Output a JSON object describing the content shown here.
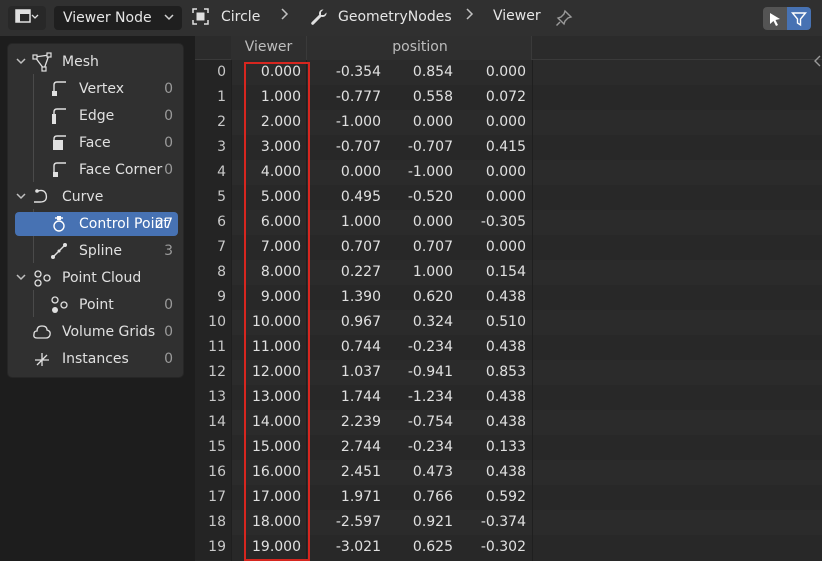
{
  "header": {
    "editor_icon": "spreadsheet-icon",
    "viewer_label": "Viewer Node",
    "breadcrumb": {
      "object": "Circle",
      "modifier": "GeometryNodes",
      "node": "Viewer"
    },
    "icons": {
      "object": "object-icon",
      "modifier": "wrench-icon",
      "pin": "pin-icon",
      "select_toggle": "cursor-select-icon",
      "filter_toggle": "funnel-filter-icon"
    }
  },
  "sidebar": {
    "items": [
      {
        "label": "Mesh",
        "count": "",
        "icon": "mesh-icon"
      },
      {
        "label": "Vertex",
        "count": "0",
        "icon": "vertex-icon"
      },
      {
        "label": "Edge",
        "count": "0",
        "icon": "edge-icon"
      },
      {
        "label": "Face",
        "count": "0",
        "icon": "face-icon"
      },
      {
        "label": "Face Corner",
        "count": "0",
        "icon": "face-corner-icon"
      },
      {
        "label": "Curve",
        "count": "",
        "icon": "curve-icon"
      },
      {
        "label": "Control Point",
        "count": "27",
        "icon": "control-point-icon"
      },
      {
        "label": "Spline",
        "count": "3",
        "icon": "spline-icon"
      },
      {
        "label": "Point Cloud",
        "count": "",
        "icon": "point-cloud-icon"
      },
      {
        "label": "Point",
        "count": "0",
        "icon": "point-icon"
      },
      {
        "label": "Volume Grids",
        "count": "0",
        "icon": "volume-icon"
      },
      {
        "label": "Instances",
        "count": "0",
        "icon": "instances-icon"
      }
    ]
  },
  "table": {
    "columns": [
      "Viewer",
      "position"
    ],
    "rows": [
      {
        "index": "0",
        "viewer": "0.000",
        "x": "-0.354",
        "y": "0.854",
        "z": "0.000"
      },
      {
        "index": "1",
        "viewer": "1.000",
        "x": "-0.777",
        "y": "0.558",
        "z": "0.072"
      },
      {
        "index": "2",
        "viewer": "2.000",
        "x": "-1.000",
        "y": "0.000",
        "z": "0.000"
      },
      {
        "index": "3",
        "viewer": "3.000",
        "x": "-0.707",
        "y": "-0.707",
        "z": "0.415"
      },
      {
        "index": "4",
        "viewer": "4.000",
        "x": "0.000",
        "y": "-1.000",
        "z": "0.000"
      },
      {
        "index": "5",
        "viewer": "5.000",
        "x": "0.495",
        "y": "-0.520",
        "z": "0.000"
      },
      {
        "index": "6",
        "viewer": "6.000",
        "x": "1.000",
        "y": "0.000",
        "z": "-0.305"
      },
      {
        "index": "7",
        "viewer": "7.000",
        "x": "0.707",
        "y": "0.707",
        "z": "0.000"
      },
      {
        "index": "8",
        "viewer": "8.000",
        "x": "0.227",
        "y": "1.000",
        "z": "0.154"
      },
      {
        "index": "9",
        "viewer": "9.000",
        "x": "1.390",
        "y": "0.620",
        "z": "0.438"
      },
      {
        "index": "10",
        "viewer": "10.000",
        "x": "0.967",
        "y": "0.324",
        "z": "0.510"
      },
      {
        "index": "11",
        "viewer": "11.000",
        "x": "0.744",
        "y": "-0.234",
        "z": "0.438"
      },
      {
        "index": "12",
        "viewer": "12.000",
        "x": "1.037",
        "y": "-0.941",
        "z": "0.853"
      },
      {
        "index": "13",
        "viewer": "13.000",
        "x": "1.744",
        "y": "-1.234",
        "z": "0.438"
      },
      {
        "index": "14",
        "viewer": "14.000",
        "x": "2.239",
        "y": "-0.754",
        "z": "0.438"
      },
      {
        "index": "15",
        "viewer": "15.000",
        "x": "2.744",
        "y": "-0.234",
        "z": "0.133"
      },
      {
        "index": "16",
        "viewer": "16.000",
        "x": "2.451",
        "y": "0.473",
        "z": "0.438"
      },
      {
        "index": "17",
        "viewer": "17.000",
        "x": "1.971",
        "y": "0.766",
        "z": "0.592"
      },
      {
        "index": "18",
        "viewer": "18.000",
        "x": "-2.597",
        "y": "0.921",
        "z": "-0.374"
      },
      {
        "index": "19",
        "viewer": "19.000",
        "x": "-3.021",
        "y": "0.625",
        "z": "-0.302"
      }
    ]
  },
  "colors": {
    "accent": "#4772b3",
    "highlight_border": "#d6261f"
  }
}
